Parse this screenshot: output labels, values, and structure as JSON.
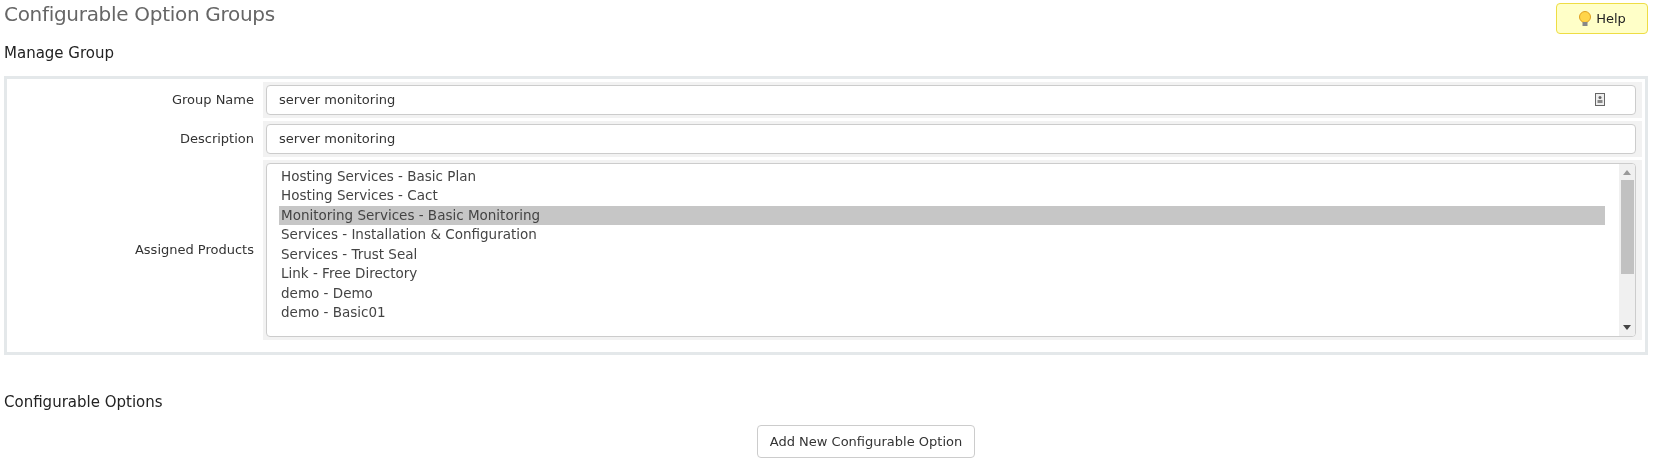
{
  "page_title": "Configurable Option Groups",
  "help_button": {
    "label": "Help"
  },
  "manage_group": {
    "heading": "Manage Group",
    "fields": [
      {
        "kind": "text",
        "label": "Group Name",
        "value": "server monitoring",
        "has_contact_icon": true
      },
      {
        "kind": "text",
        "label": "Description",
        "value": "server monitoring",
        "has_contact_icon": false
      },
      {
        "kind": "list",
        "label": "Assigned Products",
        "options": [
          {
            "text": "Hosting Services - Basic Plan",
            "selected": false
          },
          {
            "text": "Hosting Services - Cact",
            "selected": false
          },
          {
            "text": "Monitoring Services - Basic Monitoring",
            "selected": true
          },
          {
            "text": "Services - Installation & Configuration",
            "selected": false
          },
          {
            "text": "Services - Trust Seal",
            "selected": false
          },
          {
            "text": "Link - Free Directory",
            "selected": false
          },
          {
            "text": "demo - Demo",
            "selected": false
          },
          {
            "text": "demo - Basic01",
            "selected": false
          }
        ]
      }
    ]
  },
  "configurable_options": {
    "heading": "Configurable Options",
    "add_button": "Add New Configurable Option"
  }
}
